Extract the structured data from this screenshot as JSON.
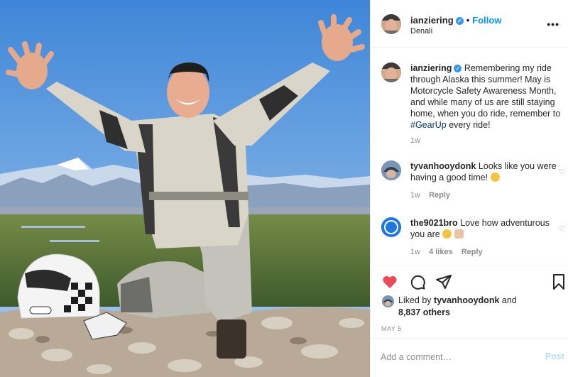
{
  "post": {
    "username": "ianziering",
    "location": "Denali",
    "follow_label": "Follow",
    "more_label": "•••"
  },
  "caption": {
    "username": "ianziering",
    "text_before": "Remembering my ride through Alaska this summer! May is Motorcycle Safety Awareness Month, and while many of us are still staying home, when you do ride, remember to ",
    "hashtag": "#GearUp",
    "text_after": " every ride!",
    "time": "1w"
  },
  "comments": [
    {
      "username": "tyvanhooydonk",
      "text": "Looks like you were having a good time!",
      "time": "1w",
      "likes": "",
      "reply_label": "Reply"
    },
    {
      "username": "the9021bro",
      "text": "Love how adventurous you are",
      "time": "1w",
      "likes": "4 likes",
      "reply_label": "Reply"
    }
  ],
  "liked_by": {
    "prefix": "Liked by ",
    "user": "tyvanhooydonk",
    "and": " and",
    "others": "8,837 others"
  },
  "date": "MAY 5",
  "comment_box": {
    "placeholder": "Add a comment…",
    "post_label": "Post"
  },
  "icons": [
    "heart-icon",
    "comment-icon",
    "share-icon",
    "bookmark-icon",
    "verified-icon",
    "more-icon"
  ],
  "colors": {
    "link": "#0095f6",
    "like_red": "#ed4956",
    "secondary_text": "#8e8e8e",
    "post_disabled": "#b2dffc"
  }
}
